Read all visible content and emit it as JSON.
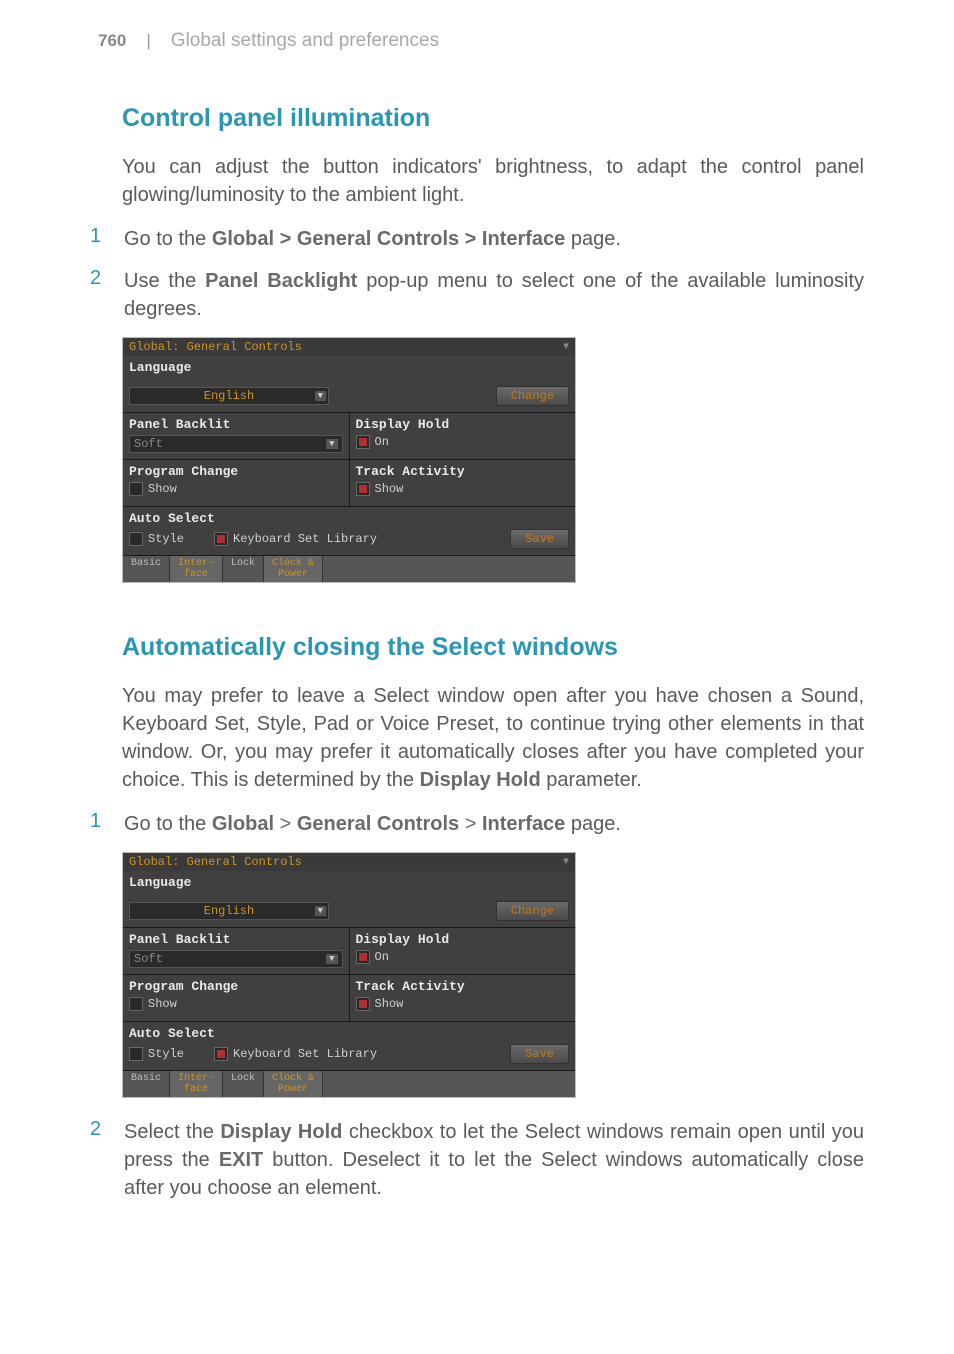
{
  "header": {
    "page_number": "760",
    "divider": "|",
    "chapter": "Global settings and preferences"
  },
  "section1": {
    "heading": "Control panel illumination",
    "intro": "You can adjust the button indicators' brightness, to adapt the control panel glowing/luminosity to the ambient light.",
    "steps": {
      "n1": "1",
      "t1a": "Go to the ",
      "t1b": "Global > General Controls > Interface",
      "t1c": " page.",
      "n2": "2",
      "t2a": "Use the ",
      "t2b": "Panel Backlight",
      "t2c": " pop-up menu to select one of the available luminosity degrees."
    }
  },
  "section2": {
    "heading": "Automatically closing the Select windows",
    "intro": "You may prefer to leave a Select window open after you have chosen a Sound, Keyboard Set, Style, Pad or Voice Preset, to continue trying other elements in that window. Or, you may prefer it automatically closes after you have completed your choice. This is determined by the ",
    "intro_bold": "Display Hold",
    "intro_end": " parameter.",
    "steps": {
      "n1": "1",
      "t1a": "Go to the ",
      "t1b": "Global",
      "t1gt1": " > ",
      "t1c": "General Controls",
      "t1gt2": " > ",
      "t1d": "Interface",
      "t1e": " page.",
      "n2": "2",
      "t2a": "Select the ",
      "t2b": "Display Hold",
      "t2c": " checkbox to let the Select windows remain open until you press the ",
      "t2d": "EXIT",
      "t2e": " button. Deselect it to let the Select windows automatically close after you choose an element."
    }
  },
  "screenshot": {
    "title": "Global: General Controls",
    "language_label": "Language",
    "language_value": "English",
    "change_btn": "Change",
    "panel_backlit_label": "Panel Backlit",
    "panel_backlit_value": "Soft",
    "display_hold_label": "Display Hold",
    "display_hold_value": "On",
    "program_change_label": "Program Change",
    "program_change_value": "Show",
    "track_activity_label": "Track Activity",
    "track_activity_value": "Show",
    "auto_select_label": "Auto Select",
    "auto_select_style": "Style",
    "auto_select_kbd": "Keyboard Set Library",
    "save_btn": "Save",
    "tabs": {
      "basic": "Basic",
      "interface": "Inter-\nface",
      "lock": "Lock",
      "clock": "Clock &\nPower"
    }
  }
}
